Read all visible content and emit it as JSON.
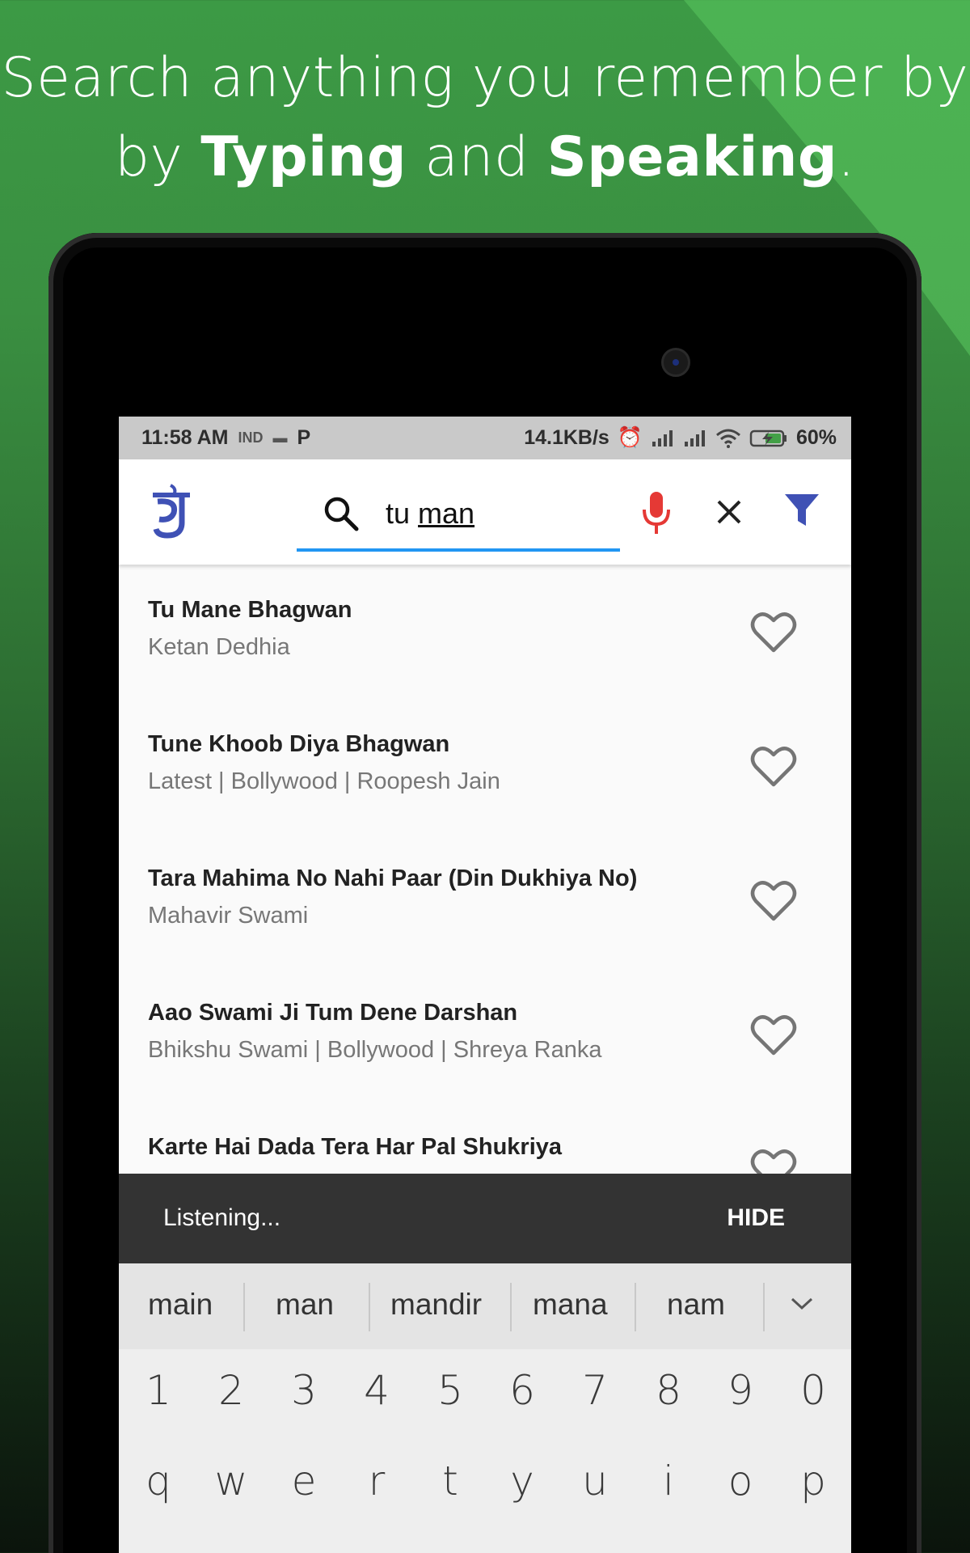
{
  "promo": {
    "line1": "Search anything you remember by",
    "line2_prefix": "by ",
    "line2_bold1": "Typing",
    "line2_mid": " and ",
    "line2_bold2": "Speaking",
    "line2_suffix": "."
  },
  "statusbar": {
    "time": "11:58 AM",
    "carrier": "IND",
    "speed": "14.1KB/s",
    "battery": "60%"
  },
  "appbar": {
    "logo_icon": "jain-logo-icon",
    "search_prefix": "tu ",
    "search_underlined": "man",
    "colors": {
      "underline": "#2196f3",
      "mic": "#e53935",
      "filter": "#3f51b5",
      "logo": "#3f51b5"
    }
  },
  "results": [
    {
      "title": "Tu Mane Bhagwan",
      "subtitle": "Ketan Dedhia"
    },
    {
      "title": "Tune Khoob Diya Bhagwan",
      "subtitle": "Latest | Bollywood | Roopesh Jain"
    },
    {
      "title": "Tara Mahima No Nahi Paar (Din Dukhiya No)",
      "subtitle": "Mahavir Swami"
    },
    {
      "title": "Aao Swami Ji Tum Dene Darshan",
      "subtitle": "Bhikshu Swami | Bollywood | Shreya Ranka"
    },
    {
      "title": "Karte Hai Dada Tera Har Pal Shukriya",
      "subtitle": ""
    }
  ],
  "snackbar": {
    "message": "Listening...",
    "action": "HIDE"
  },
  "keyboard": {
    "suggestions": [
      "main",
      "man",
      "mandir",
      "mana",
      "nam"
    ],
    "numbers": [
      "1",
      "2",
      "3",
      "4",
      "5",
      "6",
      "7",
      "8",
      "9",
      "0"
    ],
    "letters": [
      "q",
      "w",
      "e",
      "r",
      "t",
      "y",
      "u",
      "i",
      "o",
      "p"
    ]
  }
}
